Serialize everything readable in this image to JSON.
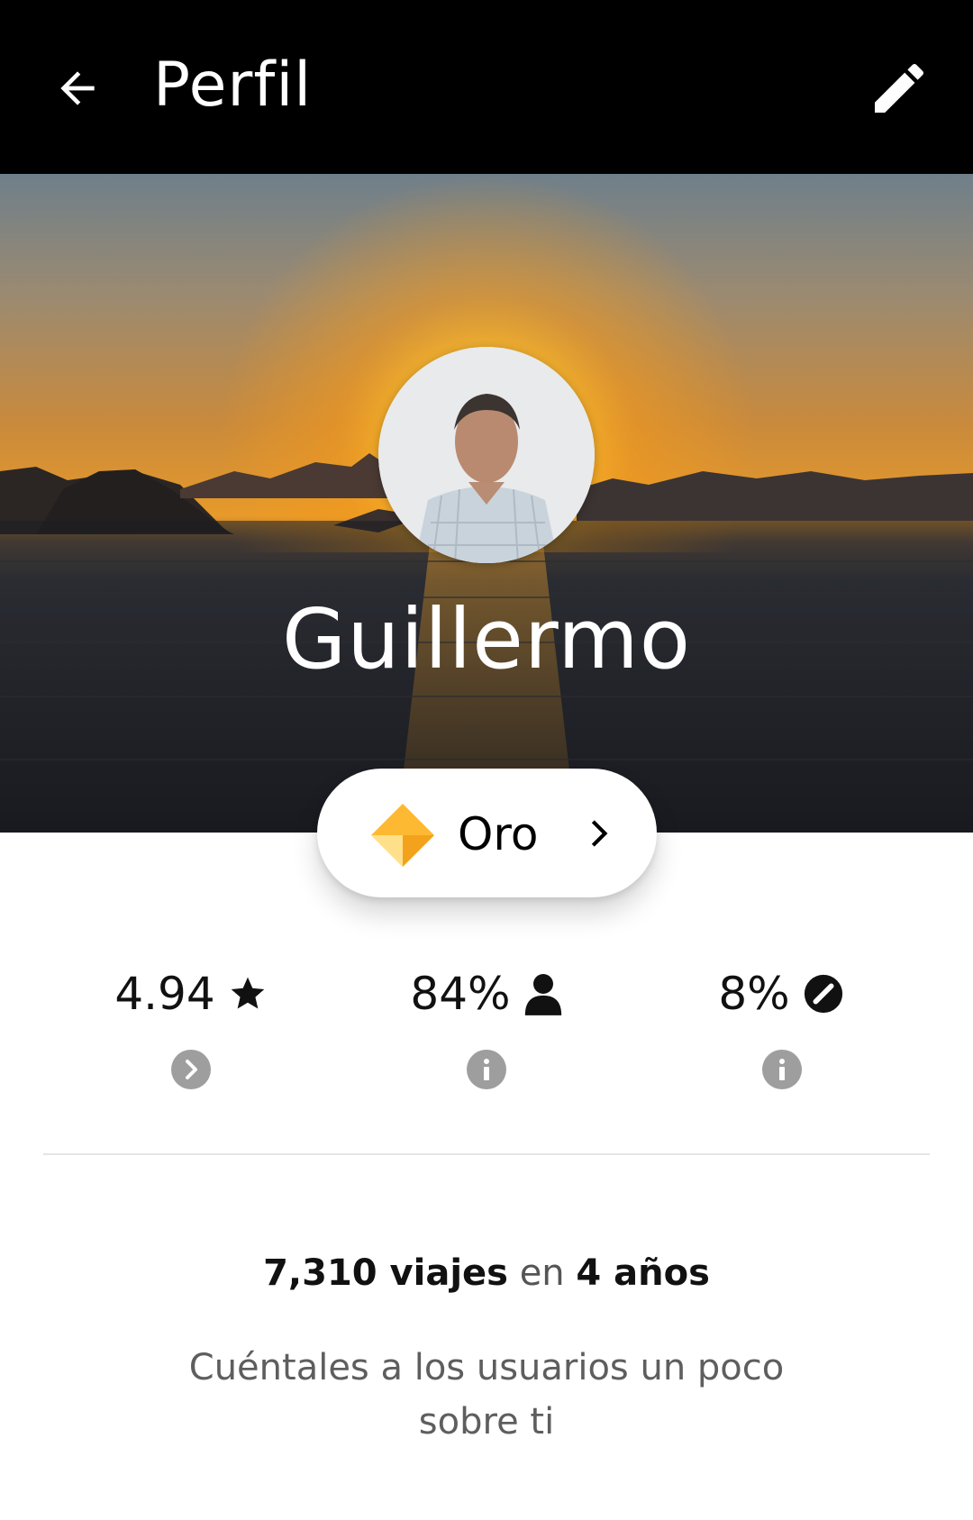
{
  "header": {
    "title": "Perfil",
    "back_icon": "arrow-left-icon",
    "edit_icon": "pencil-icon"
  },
  "profile": {
    "name": "Guillermo",
    "avatar": "profile-photo"
  },
  "tier": {
    "label": "Oro",
    "icon": "diamond-icon",
    "color": "#FDB931"
  },
  "stats": [
    {
      "value": "4.94",
      "icon": "star-icon",
      "info_icon": "chevron-right-circle-icon"
    },
    {
      "value": "84%",
      "icon": "person-icon",
      "info_icon": "info-icon"
    },
    {
      "value": "8%",
      "icon": "cancel-icon",
      "info_icon": "info-icon"
    }
  ],
  "summary": {
    "trips": "7,310 viajes",
    "connector": "en",
    "years": "4 años"
  },
  "about_prompt": "Cuéntales a los usuarios un poco sobre ti",
  "colors": {
    "header_bg": "#000000",
    "sunset_orange": "#F6A623",
    "info_grey": "#9E9E9E"
  }
}
